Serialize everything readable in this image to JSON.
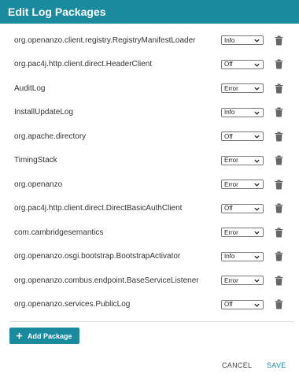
{
  "dialog": {
    "title": "Edit Log Packages",
    "add_package_label": "Add Package",
    "cancel_label": "CANCEL",
    "save_label": "SAVE"
  },
  "colors": {
    "accent": "#1a8a9e",
    "trash": "#666666"
  },
  "icons": {
    "delete": "trash-icon",
    "add": "plus-icon",
    "dropdown": "chevron-down-icon"
  },
  "packages": [
    {
      "name": "org.openanzo.client.registry.RegistryManifestLoader",
      "level": "Info"
    },
    {
      "name": "org.pac4j.http.client.direct.HeaderClient",
      "level": "Off"
    },
    {
      "name": "AuditLog",
      "level": "Error"
    },
    {
      "name": "InstallUpdateLog",
      "level": "Info"
    },
    {
      "name": "org.apache.directory",
      "level": "Off"
    },
    {
      "name": "TimingStack",
      "level": "Error"
    },
    {
      "name": "org.openanzo",
      "level": "Error"
    },
    {
      "name": "org.pac4j.http.client.direct.DirectBasicAuthClient",
      "level": "Off"
    },
    {
      "name": "com.cambridgesemantics",
      "level": "Error"
    },
    {
      "name": "org.openanzo.osgi.bootstrap.BootstrapActivator",
      "level": "Info"
    },
    {
      "name": "org.openanzo.combus.endpoint.BaseServiceListener",
      "level": "Error"
    },
    {
      "name": "org.openanzo.services.PublicLog",
      "level": "Off"
    }
  ]
}
